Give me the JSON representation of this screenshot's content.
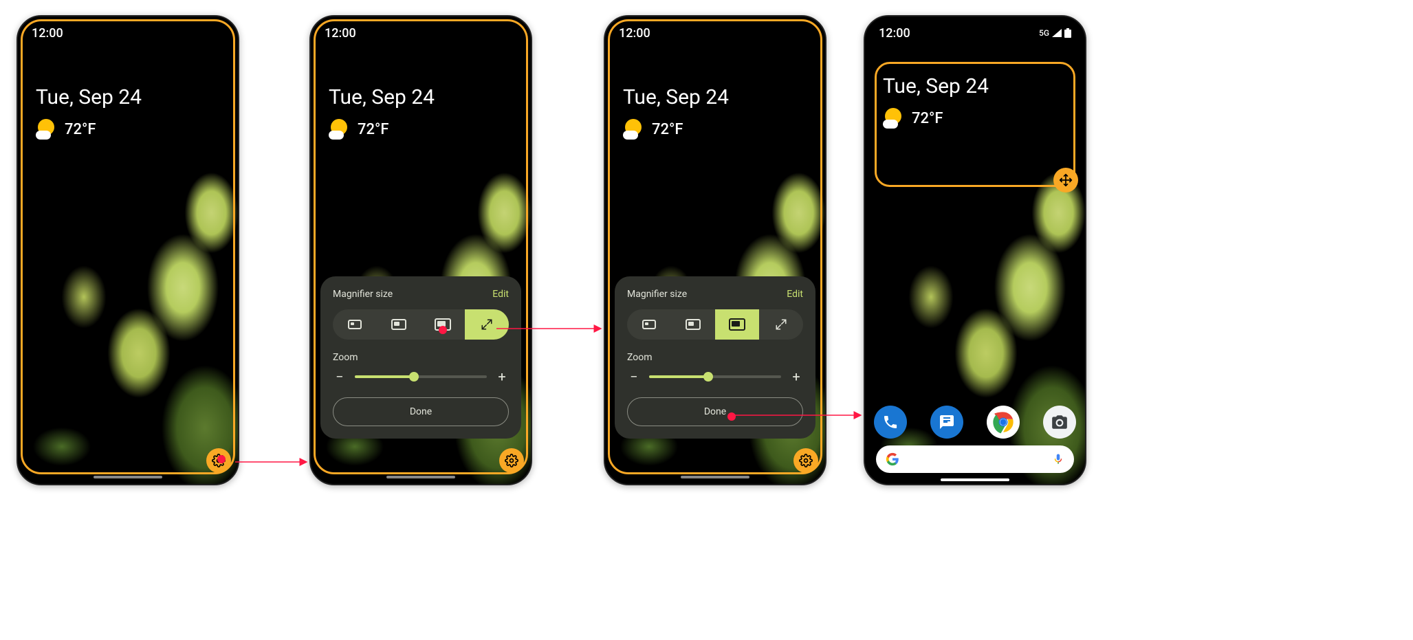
{
  "common": {
    "time": "12:00",
    "date": "Tue, Sep 24",
    "temperature": "72°F",
    "network": "5G"
  },
  "panel": {
    "title": "Magnifier size",
    "edit": "Edit",
    "zoom_label": "Zoom",
    "done": "Done",
    "zoom_percent": 45,
    "options": [
      "small",
      "medium",
      "large",
      "fullscreen"
    ]
  },
  "screens": [
    {
      "id": "s1",
      "has_panel": false,
      "mag_frame": "full",
      "gear": true
    },
    {
      "id": "s2",
      "has_panel": true,
      "active_option": "fullscreen",
      "mag_frame": "full",
      "gear": true
    },
    {
      "id": "s3",
      "has_panel": true,
      "active_option": "large",
      "mag_frame": "full",
      "gear": true
    },
    {
      "id": "s4",
      "has_panel": false,
      "mag_frame": "partial",
      "gear": false,
      "move": true,
      "has_dock": true,
      "has_status_icons": true
    }
  ],
  "glyphs": {
    "minus": "−",
    "plus": "+"
  },
  "colors": {
    "accent": "#c8e070",
    "highlight": "#f9a825",
    "panel_bg": "#2f312c"
  }
}
